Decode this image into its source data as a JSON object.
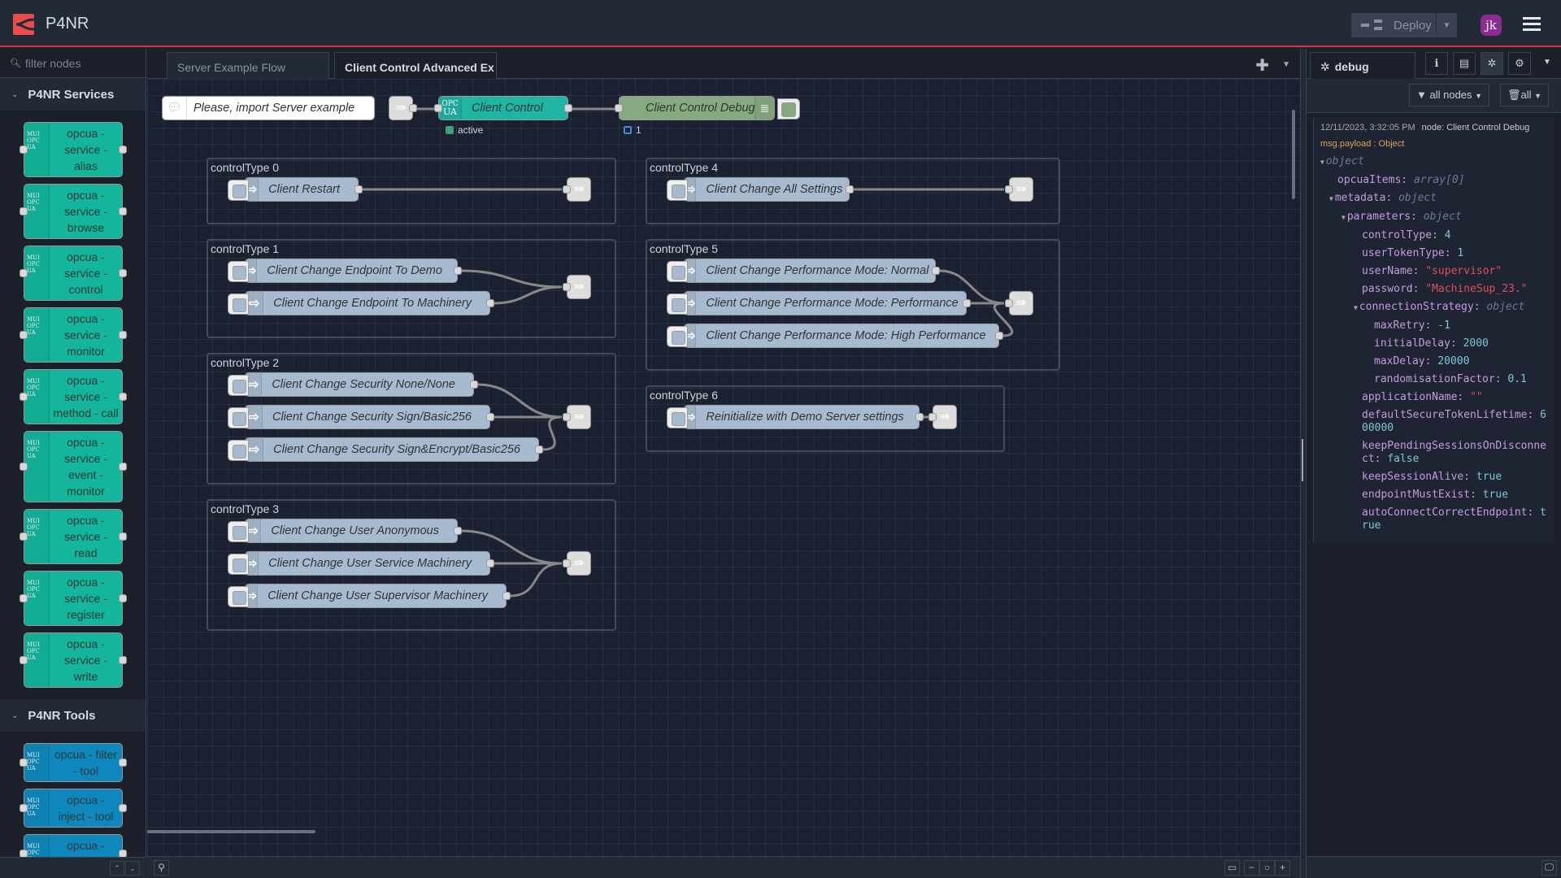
{
  "header": {
    "title": "P4NR",
    "deploy_label": "Deploy",
    "avatar_initials": "jk",
    "accent_color": "#d6353c"
  },
  "palette": {
    "filter_placeholder": "filter nodes",
    "categories": [
      {
        "title": "P4NR Services",
        "nodes": [
          "opcua - service - alias",
          "opcua - service - browse",
          "opcua - service - control",
          "opcua - service - monitor",
          "opcua - service - method - call",
          "opcua - service - event - monitor",
          "opcua - service - read",
          "opcua - service - register",
          "opcua - service - write"
        ]
      },
      {
        "title": "P4NR Tools",
        "nodes": [
          "opcua - filter - tool",
          "opcua - inject - tool",
          "opcua - model - tool"
        ]
      }
    ],
    "icon_text": [
      "MUI",
      "OPC",
      "UA"
    ]
  },
  "workspace": {
    "tabs": [
      {
        "label": "Server Example Flow",
        "active": false
      },
      {
        "label": "Client Control Advanced Ex",
        "active": true
      }
    ],
    "comment": "Please, import Server example",
    "client_control": {
      "label": "Client Control",
      "status": "active",
      "icon": [
        "OPC",
        "UA"
      ]
    },
    "debug_node": {
      "label": "Client Control Debug",
      "count": "1"
    },
    "groups": [
      {
        "label": "controlType 0",
        "nodes": [
          "Client Restart"
        ]
      },
      {
        "label": "controlType 1",
        "nodes": [
          "Client Change Endpoint To Demo",
          "Client Change Endpoint To Machinery"
        ]
      },
      {
        "label": "controlType 2",
        "nodes": [
          "Client Change Security None/None",
          "Client Change Security Sign/Basic256",
          "Client Change Security Sign&Encrypt/Basic256"
        ]
      },
      {
        "label": "controlType 3",
        "nodes": [
          "Client Change User Anonymous",
          "Client Change User Service Machinery",
          "Client Change User Supervisor Machinery"
        ]
      },
      {
        "label": "controlType 4",
        "nodes": [
          "Client Change All Settings"
        ]
      },
      {
        "label": "controlType 5",
        "nodes": [
          "Client Change Performance Mode: Normal",
          "Client Change Performance Mode: Performance",
          "Client Change Performance Mode: High Performance"
        ]
      },
      {
        "label": "controlType 6",
        "nodes": [
          "Reinitialize with Demo Server settings"
        ]
      }
    ]
  },
  "sidebar": {
    "tab_label": "debug",
    "filter_label": "all nodes",
    "clear_label": "all",
    "message": {
      "timestamp": "12/11/2023, 3:32:05 PM",
      "node": "node: Client Control Debug",
      "path": "msg.payload : Object",
      "root_type": "object",
      "rows": [
        {
          "key": "opcuaItems",
          "val": "array[0]",
          "kind": "t",
          "indent": 1
        },
        {
          "key": "metadata",
          "val": "object",
          "kind": "t",
          "indent": 1,
          "expanded": true
        },
        {
          "key": "parameters",
          "val": "object",
          "kind": "t",
          "indent": 2,
          "expanded": true
        },
        {
          "key": "controlType",
          "val": "4",
          "kind": "n",
          "indent": 3
        },
        {
          "key": "userTokenType",
          "val": "1",
          "kind": "n",
          "indent": 3
        },
        {
          "key": "userName",
          "val": "\"supervisor\"",
          "kind": "s",
          "indent": 3
        },
        {
          "key": "password",
          "val": "\"MachineSup_23.\"",
          "kind": "s",
          "indent": 3
        },
        {
          "key": "connectionStrategy",
          "val": "object",
          "kind": "t",
          "indent": 3,
          "expanded": true
        },
        {
          "key": "maxRetry",
          "val": "-1",
          "kind": "n",
          "indent": 4
        },
        {
          "key": "initialDelay",
          "val": "2000",
          "kind": "n",
          "indent": 4
        },
        {
          "key": "maxDelay",
          "val": "20000",
          "kind": "n",
          "indent": 4
        },
        {
          "key": "randomisationFactor",
          "val": "0.1",
          "kind": "n",
          "indent": 4
        },
        {
          "key": "applicationName",
          "val": "\"\"",
          "kind": "s",
          "indent": 3
        },
        {
          "key": "defaultSecureTokenLifetime",
          "val": "600000",
          "kind": "n",
          "indent": 3
        },
        {
          "key": "keepPendingSessionsOnDisconnect",
          "val": "false",
          "kind": "n",
          "indent": 3
        },
        {
          "key": "keepSessionAlive",
          "val": "true",
          "kind": "n",
          "indent": 3
        },
        {
          "key": "endpointMustExist",
          "val": "true",
          "kind": "n",
          "indent": 3
        },
        {
          "key": "autoConnectCorrectEndpoint",
          "val": "true",
          "kind": "n",
          "indent": 3
        }
      ]
    }
  }
}
